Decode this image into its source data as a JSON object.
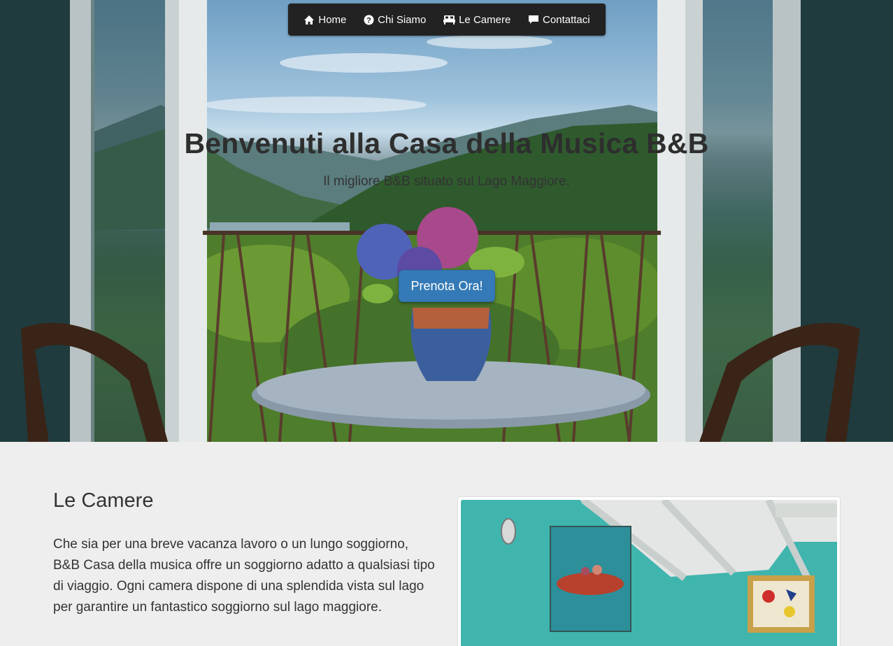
{
  "nav": {
    "items": [
      {
        "label": "Home",
        "icon": "home-icon"
      },
      {
        "label": "Chi Siamo",
        "icon": "question-circle-icon"
      },
      {
        "label": "Le Camere",
        "icon": "bed-icon"
      },
      {
        "label": "Contattaci",
        "icon": "comment-icon"
      }
    ]
  },
  "hero": {
    "title": "Benvenuti alla Casa della Musica B&B",
    "subtitle": "Il migliore B&B situato sul Lago Maggiore.",
    "cta_label": "Prenota Ora!"
  },
  "rooms": {
    "title": "Le Camere",
    "text": "Che sia per una breve vacanza lavoro o un lungo soggiorno, B&B Casa della musica offre un soggiorno adatto a qualsiasi tipo di viaggio. Ogni camera dispone di una splendida vista sul lago per garantire un fantastico soggiorno sul lago maggiore."
  },
  "colors": {
    "nav_bg": "#222222",
    "cta_bg": "#337ab7",
    "page_bg": "#eeeeee",
    "room_wall": "#3db6b0"
  }
}
